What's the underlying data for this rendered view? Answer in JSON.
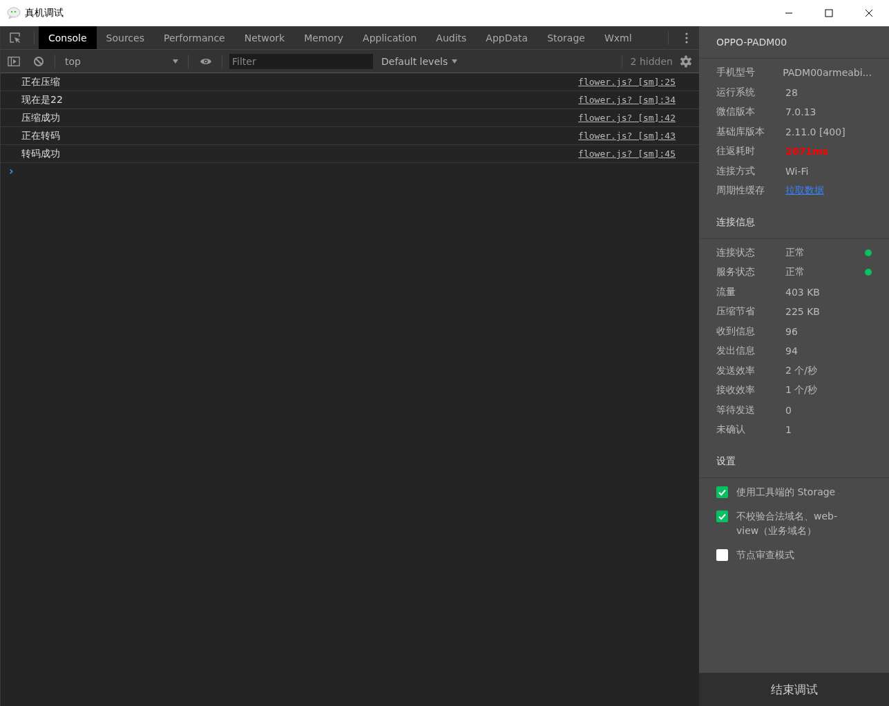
{
  "window": {
    "title": "真机调试"
  },
  "tabs": [
    {
      "label": "Console",
      "selected": true
    },
    {
      "label": "Sources",
      "selected": false
    },
    {
      "label": "Performance",
      "selected": false
    },
    {
      "label": "Network",
      "selected": false
    },
    {
      "label": "Memory",
      "selected": false
    },
    {
      "label": "Application",
      "selected": false
    },
    {
      "label": "Audits",
      "selected": false
    },
    {
      "label": "AppData",
      "selected": false
    },
    {
      "label": "Storage",
      "selected": false
    },
    {
      "label": "Wxml",
      "selected": false
    }
  ],
  "toolbar": {
    "context": "top",
    "filter_placeholder": "Filter",
    "levels": "Default levels",
    "hidden_count": "2 hidden"
  },
  "console": {
    "messages": [
      {
        "text": "正在压缩",
        "source": "flower.js? [sm]:25"
      },
      {
        "text": "现在是22",
        "source": "flower.js? [sm]:34"
      },
      {
        "text": "压缩成功",
        "source": "flower.js? [sm]:42"
      },
      {
        "text": "正在转码",
        "source": "flower.js? [sm]:43"
      },
      {
        "text": "转码成功",
        "source": "flower.js? [sm]:45"
      }
    ],
    "prompt": "›"
  },
  "device": {
    "name": "OPPO-PADM00",
    "rows": [
      {
        "label": "手机型号",
        "value": "PADM00armeabi...",
        "kind": "plain"
      },
      {
        "label": "运行系统",
        "value": "28",
        "kind": "plain"
      },
      {
        "label": "微信版本",
        "value": "7.0.13",
        "kind": "plain"
      },
      {
        "label": "基础库版本",
        "value": "2.11.0 [400]",
        "kind": "plain"
      },
      {
        "label": "往返耗时",
        "value": "2671ms",
        "kind": "alert"
      },
      {
        "label": "连接方式",
        "value": "Wi-Fi",
        "kind": "plain"
      },
      {
        "label": "周期性缓存",
        "value": "拉取数据",
        "kind": "link"
      }
    ]
  },
  "connection": {
    "title": "连接信息",
    "rows": [
      {
        "label": "连接状态",
        "value": "正常",
        "color": "#07c160"
      },
      {
        "label": "服务状态",
        "value": "正常",
        "color": "#07c160"
      },
      {
        "label": "流量",
        "value": "403 KB"
      },
      {
        "label": "压缩节省",
        "value": "225 KB"
      },
      {
        "label": "收到信息",
        "value": "96"
      },
      {
        "label": "发出信息",
        "value": "94"
      },
      {
        "label": "发送效率",
        "value": "2 个/秒"
      },
      {
        "label": "接收效率",
        "value": "1 个/秒"
      },
      {
        "label": "等待发送",
        "value": "0"
      },
      {
        "label": "未确认",
        "value": "1"
      }
    ]
  },
  "settings": {
    "title": "设置",
    "options": [
      {
        "label": "使用工具端的 Storage",
        "checked": true
      },
      {
        "label": "不校验合法域名、web-view（业务域名）",
        "checked": true
      },
      {
        "label": "节点审查模式",
        "checked": false
      }
    ]
  },
  "end_button": "结束调试"
}
